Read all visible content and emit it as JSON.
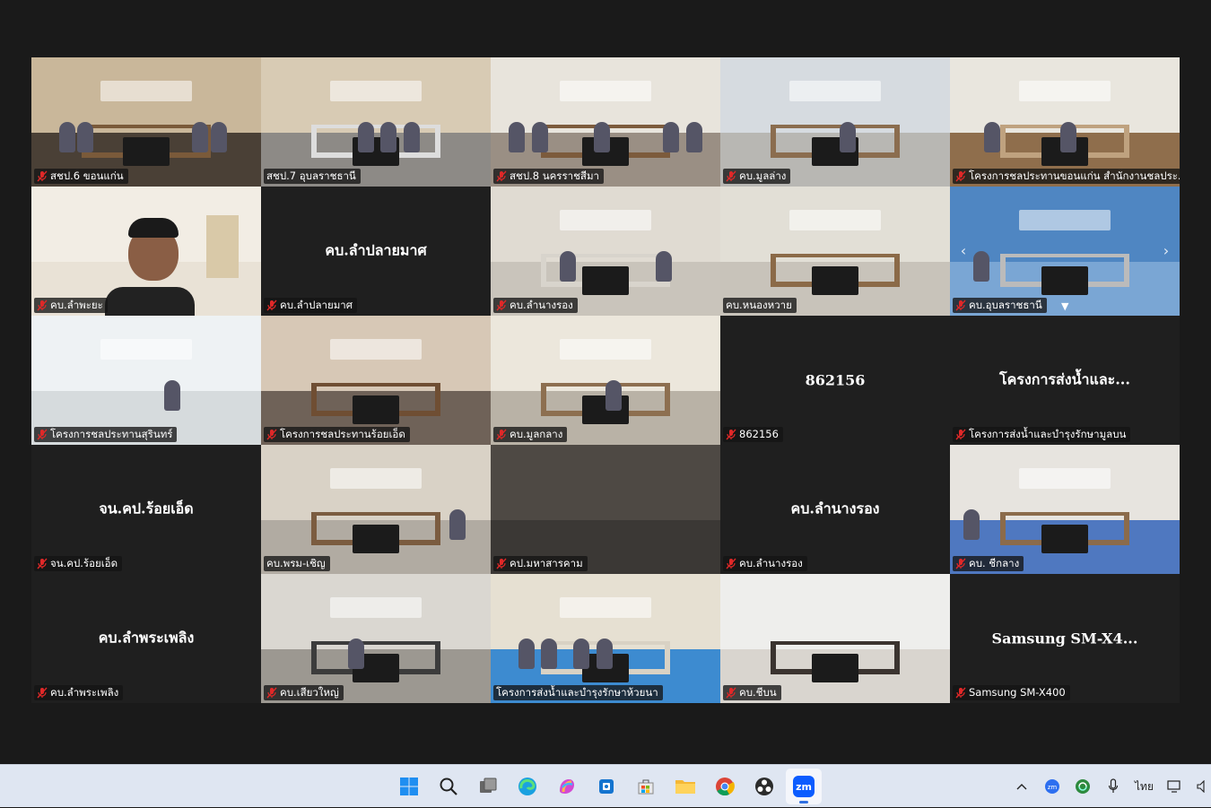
{
  "meeting": {
    "tiles": [
      {
        "label": "สชป.6 ขอนแก่น",
        "mode": "video",
        "scene": "room-a",
        "muted": true
      },
      {
        "label": "สชป.7 อุบลราชธานี",
        "mode": "video",
        "scene": "room-b",
        "muted": false,
        "active": true
      },
      {
        "label": "สชป.8 นครราชสีมา",
        "mode": "video",
        "scene": "room-c",
        "muted": true
      },
      {
        "label": "คบ.มูลล่าง",
        "mode": "video",
        "scene": "room-d",
        "muted": true
      },
      {
        "label": "โครงการชลประทานขอนแก่น สำนักงานชลประ...",
        "mode": "video",
        "scene": "room-e",
        "muted": true
      },
      {
        "label": "คบ.ลำพะยะ",
        "mode": "video",
        "scene": "person",
        "muted": true
      },
      {
        "label": "คบ.ลำปลายมาศ",
        "mode": "name",
        "name": "คบ.ลำปลายมาศ",
        "muted": true
      },
      {
        "label": "คบ.ลำนางรอง",
        "mode": "video",
        "scene": "room-f",
        "muted": true
      },
      {
        "label": "คบ.หนองหวาย",
        "mode": "video",
        "scene": "room-g",
        "muted": false
      },
      {
        "label": "คบ.อุบลราชธานี",
        "mode": "video",
        "scene": "room-h",
        "muted": true,
        "nav": true
      },
      {
        "label": "โครงการชลประทานสุรินทร์",
        "mode": "video",
        "scene": "room-i",
        "muted": true
      },
      {
        "label": "โครงการชลประทานร้อยเอ็ด",
        "mode": "video",
        "scene": "room-j",
        "muted": true
      },
      {
        "label": "คบ.มูลกลาง",
        "mode": "video",
        "scene": "room-k",
        "muted": true
      },
      {
        "label": "862156",
        "mode": "name",
        "name": "862156",
        "muted": true
      },
      {
        "label": "โครงการส่งน้ำและบำรุงรักษามูลบน",
        "mode": "name",
        "name": "โครงการส่งน้ำและ...",
        "muted": true
      },
      {
        "label": "จน.คป.ร้อยเอ็ด",
        "mode": "name",
        "name": "จน.คป.ร้อยเอ็ด",
        "muted": true
      },
      {
        "label": "คบ.พรม-เชิญ",
        "mode": "video",
        "scene": "room-l",
        "muted": false
      },
      {
        "label": "คป.มหาสารคาม",
        "mode": "video",
        "scene": "room-m",
        "muted": true
      },
      {
        "label": "คบ.ลำนางรอง",
        "mode": "name",
        "name": "คบ.ลำนางรอง",
        "muted": true
      },
      {
        "label": "คบ. ชีกลาง",
        "mode": "video",
        "scene": "room-n",
        "muted": true
      },
      {
        "label": "คบ.ลำพระเพลิง",
        "mode": "name",
        "name": "คบ.ลำพระเพลิง",
        "muted": true
      },
      {
        "label": "คบ.เสียวใหญ่",
        "mode": "video",
        "scene": "room-o",
        "muted": true
      },
      {
        "label": "โครงการส่งน้ำและบำรุงรักษาห้วยนา",
        "mode": "video",
        "scene": "room-p",
        "muted": false
      },
      {
        "label": "คบ.ชีบน",
        "mode": "video",
        "scene": "room-q",
        "muted": true
      },
      {
        "label": "Samsung SM-X400",
        "mode": "name",
        "name": "Samsung  SM-X4...",
        "muted": true
      }
    ]
  },
  "taskbar": {
    "apps": [
      {
        "name": "start-icon"
      },
      {
        "name": "search-icon"
      },
      {
        "name": "task-view-icon"
      },
      {
        "name": "edge-icon"
      },
      {
        "name": "copilot-icon"
      },
      {
        "name": "outlook-icon"
      },
      {
        "name": "store-icon"
      },
      {
        "name": "file-explorer-icon"
      },
      {
        "name": "chrome-icon"
      },
      {
        "name": "obs-icon"
      },
      {
        "name": "zoom-icon",
        "text": "zm",
        "active": true
      }
    ],
    "tray": {
      "language": "ไทย"
    }
  },
  "colors": {
    "background": "#1a1a1a",
    "active_border": "#23d18b",
    "muted_red": "#e02828",
    "taskbar": "#dfe6f2"
  }
}
